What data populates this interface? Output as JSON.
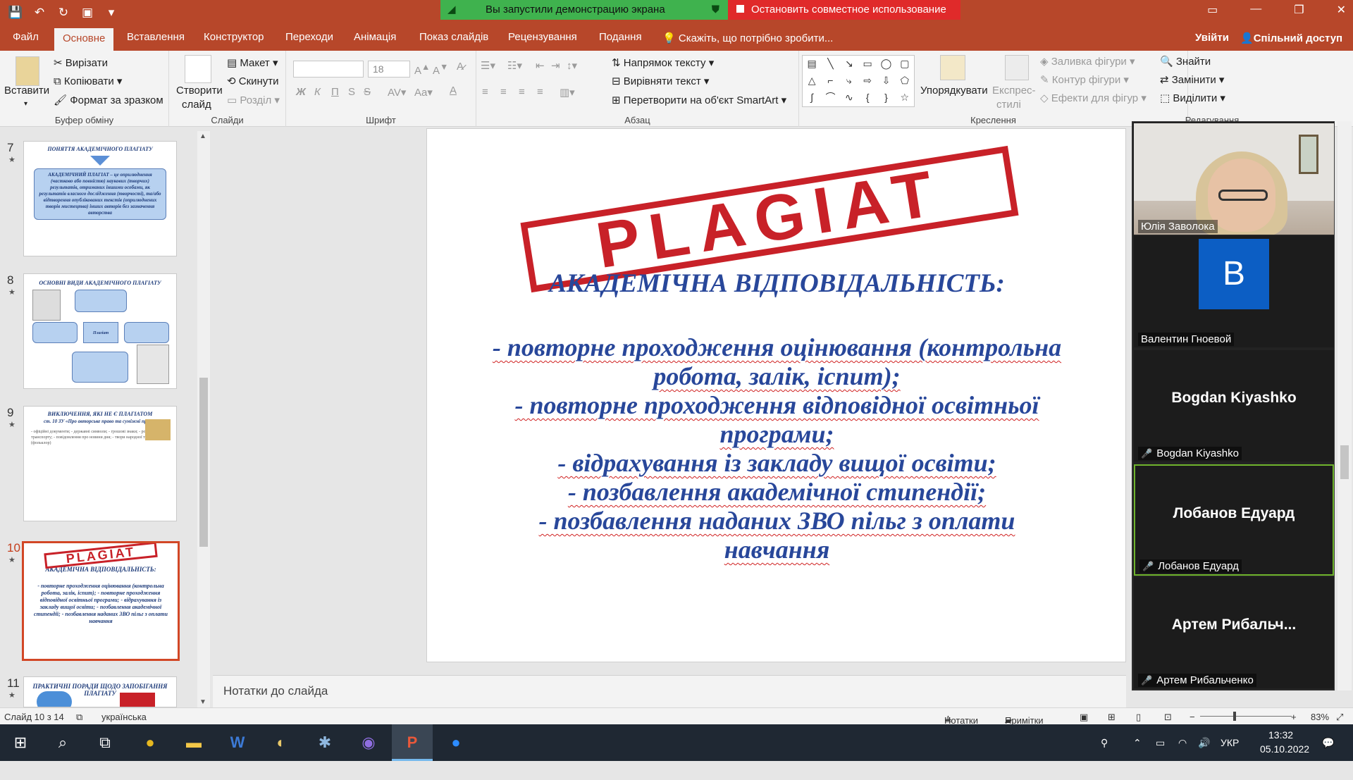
{
  "qat": {
    "save": "💾",
    "undo": "↶",
    "redo": "↻",
    "start_show": "▣",
    "more": "▾"
  },
  "share": {
    "status": "Вы запустили демонстрацию экрана",
    "stop": "Остановить совместное использование"
  },
  "window": {
    "restore": "▭",
    "minimize": "—",
    "maximize": "❐",
    "close": "✕"
  },
  "tabs": [
    "Файл",
    "Основне",
    "Вставлення",
    "Конструктор",
    "Переходи",
    "Анімація",
    "Показ слайдів",
    "Рецензування",
    "Подання"
  ],
  "tellme": "Скажіть, що потрібно зробити...",
  "signin": "Увійти",
  "share_btn": "Спільний доступ",
  "ribbon": {
    "paste": "Вставити",
    "cut": "Вирізати",
    "copy": "Копіювати",
    "format_painter": "Формат за зразком",
    "clipboard": "Буфер обміну",
    "new_slide": "Створити",
    "new_slide2": "слайд",
    "layout": "Макет",
    "reset": "Скинути",
    "section": "Розділ",
    "slides": "Слайди",
    "font_size": "18",
    "font": "Шрифт",
    "bold": "Ж",
    "italic": "К",
    "underline": "П",
    "strike": "S",
    "spacing": "AV",
    "case": "Aa",
    "paragraph": "Абзац",
    "text_dir": "Напрямок тексту",
    "align_text": "Вирівняти текст",
    "smartart": "Перетворити на об'єкт SmartArt",
    "arrange": "Упорядкувати",
    "quick_styles": "Експрес-",
    "quick_styles2": "стилі",
    "fill": "Заливка фігури",
    "outline": "Контур фігури",
    "effects": "Ефекти для фігур",
    "drawing": "Креслення",
    "find": "Знайти",
    "replace": "Замінити",
    "select": "Виділити",
    "editing": "Редагування"
  },
  "thumbs": [
    {
      "num": "7",
      "title": "ПОНЯТТЯ АКАДЕМІЧНОГО ПЛАГІАТУ",
      "body": "АКАДЕМІЧНИЙ ПЛАГІАТ – це оприлюднення (частково або повністю) наукових (творчих) результатів, отриманих іншими особами, як результатів власного дослідження (творчості), та/або відтворення опублікованих текстів (оприлюднених творів мистецтва) інших авторів без зазначення авторства"
    },
    {
      "num": "8",
      "title": "ОСНОВНІ ВИДИ АКАДЕМІЧНОГО ПЛАГІАТУ",
      "body": "Плагіат"
    },
    {
      "num": "9",
      "title": "ВИКЛЮЧЕННЯ, ЯКІ НЕ Є ПЛАГІАТОМ",
      "subtitle": "ст. 10 ЗУ «Про авторське право та суміжні права»",
      "body": "- офіційні документи; - державні символи; - грошові знаки; - розклади руху транспорту; - повідомлення про новини дня; - твори народної творчості (фольклор)"
    },
    {
      "num": "10",
      "stamp": "PLAGIAT",
      "title": "АКАДЕМІЧНА ВІДПОВІДАЛЬНІСТЬ:",
      "body": "- повторне проходження оцінювання (контрольна робота, залік, іспит); - повторне проходження відповідної освітньої програми; - відрахування із закладу вищої освіти; - позбавлення академічної стипендії; - позбавлення наданих ЗВО пільг з оплати навчання"
    },
    {
      "num": "11",
      "title": "ПРАКТИЧНІ ПОРАДИ ЩОДО ЗАПОБІГАННЯ ПЛАГІАТУ",
      "body": ""
    }
  ],
  "slide": {
    "stamp": "PLAGIAT",
    "title": "АКАДЕМІЧНА ВІДПОВІДАЛЬНІСТЬ:",
    "lines": [
      "- повторне проходження оцінювання (контрольна",
      "робота, залік, іспит);",
      "- повторне проходження відповідної освітньої",
      "програми;",
      "- відрахування із закладу вищої освіти;",
      "- позбавлення академічної стипендії;",
      "- позбавлення наданих ЗВО пільг з оплати",
      "навчання"
    ]
  },
  "notes_placeholder": "Нотатки до слайда",
  "status": {
    "slide": "Слайд 10 з 14",
    "lang": "українська",
    "notes": "Нотатки",
    "comments": "Примітки",
    "zoom": "83%"
  },
  "participants": [
    {
      "name": "Юлія Заволока",
      "type": "video"
    },
    {
      "name": "Валентин Гноевой",
      "type": "avatar",
      "initial": "B"
    },
    {
      "name": "Bogdan Kiyashko",
      "type": "name",
      "display": "Bogdan Kiyashko"
    },
    {
      "name": "Лобанов Едуард",
      "type": "name",
      "display": "Лобанов Едуард"
    },
    {
      "name": "Артем Рибальченко",
      "type": "name",
      "display": "Артем  Рибальч..."
    }
  ],
  "taskbar": {
    "apps": [
      "start",
      "search",
      "task-view",
      "chrome",
      "explorer",
      "word",
      "paint",
      "photos",
      "viber",
      "powerpoint",
      "zoom"
    ],
    "lang": "УКР",
    "time": "13:32",
    "date": "05.10.2022"
  },
  "colors": {
    "accent": "#b7472a",
    "slide_text": "#28479a",
    "stamp": "#c82128",
    "share_green": "#3fb24e",
    "share_red": "#e02a2a"
  }
}
